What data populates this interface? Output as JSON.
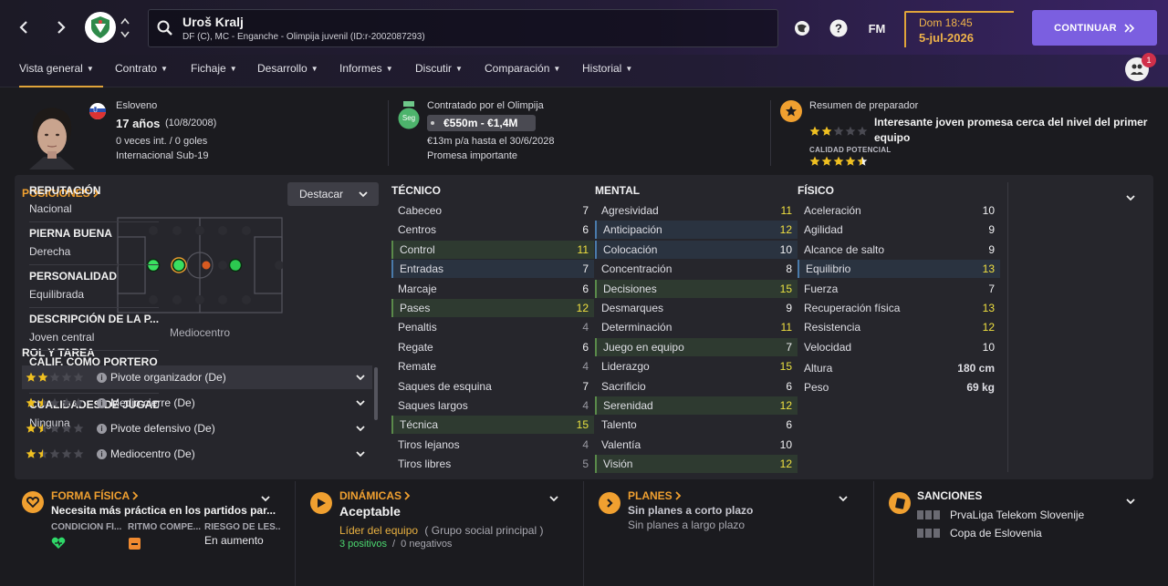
{
  "topbar": {
    "player_name": "Uroš Kralj",
    "player_subtitle": "DF (C), MC - Enganche - Olimpija juvenil (ID:r-2002087293)",
    "fm_label": "FM",
    "date_day": "Dom 18:45",
    "date_date": "5-jul-2026",
    "continue_label": "CONTINUAR",
    "notification_count": "1"
  },
  "tabs": [
    {
      "label": "Vista general"
    },
    {
      "label": "Contrato"
    },
    {
      "label": "Fichaje"
    },
    {
      "label": "Desarrollo"
    },
    {
      "label": "Informes"
    },
    {
      "label": "Discutir"
    },
    {
      "label": "Comparación"
    },
    {
      "label": "Historial"
    }
  ],
  "profile": {
    "nationality": "Esloveno",
    "age": "17 años",
    "birth": "(10/8/2008)",
    "caps": "0 veces int. / 0 goles",
    "intl_level": "Internacional Sub-19"
  },
  "contract": {
    "title": "Contratado por el Olimpija",
    "badge": "Seg",
    "value_range": "€550m - €1,4M",
    "wage": "€13m p/a hasta el 30/6/2028",
    "status": "Promesa importante"
  },
  "coach": {
    "title": "Resumen de preparador",
    "summary": "Interesante joven promesa cerca del nivel del primer equipo",
    "current_ability_stars": 2,
    "potential_label": "CALIDAD POTENCIAL",
    "potential_stars": 4.5
  },
  "positions": {
    "title": "POSICIONES",
    "highlight_label": "Destacar",
    "position_name": "Mediocentro"
  },
  "roles": {
    "title": "ROL Y TAREA",
    "items": [
      {
        "label": "Pivote organizador (De)",
        "stars": 2
      },
      {
        "label": "Medio cierre (De)",
        "stars": 1.5
      },
      {
        "label": "Pivote defensivo (De)",
        "stars": 1.5
      },
      {
        "label": "Mediocentro (De)",
        "stars": 1.5
      }
    ]
  },
  "technical": {
    "title": "TÉCNICO",
    "rows": [
      {
        "name": "Cabeceo",
        "value": "7",
        "hl": ""
      },
      {
        "name": "Centros",
        "value": "6",
        "hl": ""
      },
      {
        "name": "Control",
        "value": "11",
        "hl": "green"
      },
      {
        "name": "Entradas",
        "value": "7",
        "hl": "blue"
      },
      {
        "name": "Marcaje",
        "value": "6",
        "hl": ""
      },
      {
        "name": "Pases",
        "value": "12",
        "hl": "green"
      },
      {
        "name": "Penaltis",
        "value": "4",
        "hl": ""
      },
      {
        "name": "Regate",
        "value": "6",
        "hl": ""
      },
      {
        "name": "Remate",
        "value": "4",
        "hl": ""
      },
      {
        "name": "Saques de esquina",
        "value": "7",
        "hl": ""
      },
      {
        "name": "Saques largos",
        "value": "4",
        "hl": ""
      },
      {
        "name": "Técnica",
        "value": "15",
        "hl": "green"
      },
      {
        "name": "Tiros lejanos",
        "value": "4",
        "hl": ""
      },
      {
        "name": "Tiros libres",
        "value": "5",
        "hl": ""
      }
    ]
  },
  "mental": {
    "title": "MENTAL",
    "rows": [
      {
        "name": "Agresividad",
        "value": "11",
        "hl": ""
      },
      {
        "name": "Anticipación",
        "value": "12",
        "hl": "blue"
      },
      {
        "name": "Colocación",
        "value": "10",
        "hl": "blue"
      },
      {
        "name": "Concentración",
        "value": "8",
        "hl": ""
      },
      {
        "name": "Decisiones",
        "value": "15",
        "hl": "green"
      },
      {
        "name": "Desmarques",
        "value": "9",
        "hl": ""
      },
      {
        "name": "Determinación",
        "value": "11",
        "hl": ""
      },
      {
        "name": "Juego en equipo",
        "value": "7",
        "hl": "green"
      },
      {
        "name": "Liderazgo",
        "value": "15",
        "hl": ""
      },
      {
        "name": "Sacrificio",
        "value": "6",
        "hl": ""
      },
      {
        "name": "Serenidad",
        "value": "12",
        "hl": "green"
      },
      {
        "name": "Talento",
        "value": "6",
        "hl": ""
      },
      {
        "name": "Valentía",
        "value": "10",
        "hl": ""
      },
      {
        "name": "Visión",
        "value": "12",
        "hl": "green"
      }
    ]
  },
  "physical": {
    "title": "FÍSICO",
    "rows": [
      {
        "name": "Aceleración",
        "value": "10",
        "hl": ""
      },
      {
        "name": "Agilidad",
        "value": "9",
        "hl": ""
      },
      {
        "name": "Alcance de salto",
        "value": "9",
        "hl": ""
      },
      {
        "name": "Equilibrio",
        "value": "13",
        "hl": "blue"
      },
      {
        "name": "Fuerza",
        "value": "7",
        "hl": ""
      },
      {
        "name": "Recuperación física",
        "value": "13",
        "hl": ""
      },
      {
        "name": "Resistencia",
        "value": "12",
        "hl": ""
      },
      {
        "name": "Velocidad",
        "value": "10",
        "hl": ""
      }
    ],
    "height_label": "Altura",
    "height": "180 cm",
    "weight_label": "Peso",
    "weight": "69 kg"
  },
  "side": [
    {
      "label": "REPUTACIÓN",
      "value": "Nacional"
    },
    {
      "label": "PIERNA BUENA",
      "value": "Derecha"
    },
    {
      "label": "PERSONALIDAD",
      "value": "Equilibrada"
    },
    {
      "label": "DESCRIPCIÓN DE LA P...",
      "value": "Joven central"
    },
    {
      "label": "CALIF. COMO PORTERO",
      "value": "2"
    },
    {
      "label": "CUALIDADES DE JUGADO",
      "value": "Ninguna"
    }
  ],
  "fitness": {
    "title": "FORMA FÍSICA",
    "summary": "Necesita más práctica en los partidos par...",
    "cols": [
      "CONDICIÓN FÍ...",
      "RITMO COMPE...",
      "RIESGO DE LES..."
    ],
    "risk_value": "En aumento"
  },
  "dynamics": {
    "title": "DINÁMICAS",
    "status": "Aceptable",
    "leader": "Líder del equipo",
    "group": "( Grupo social principal )",
    "positives": "3 positivos",
    "sep": "/",
    "negatives": "0 negativos"
  },
  "plans": {
    "title": "PLANES",
    "short": "Sin planes a corto plazo",
    "long": "Sin planes a largo plazo"
  },
  "sanctions": {
    "title": "SANCIONES",
    "items": [
      "PrvaLiga Telekom Slovenije",
      "Copa de Eslovenia"
    ]
  },
  "colors": {
    "accent": "#f0a030",
    "attr_high": "#f0e040",
    "button": "#7b5fe0"
  }
}
